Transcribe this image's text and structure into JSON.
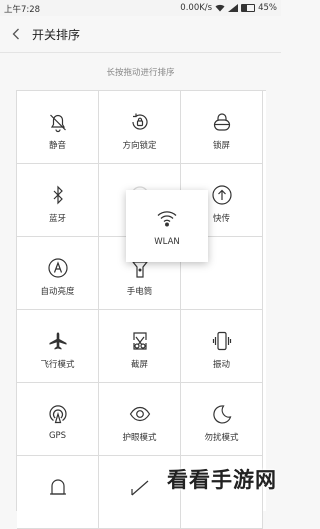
{
  "status_bar": {
    "time": "上午7:28",
    "speed": "0.00K/s",
    "battery": "45%"
  },
  "header": {
    "title": "开关排序"
  },
  "hint": "长按拖动进行排序",
  "tiles": [
    {
      "label": "静音",
      "icon": "bell-off-icon"
    },
    {
      "label": "方向锁定",
      "icon": "rotation-lock-icon"
    },
    {
      "label": "锁屏",
      "icon": "lock-icon"
    },
    {
      "label": "蓝牙",
      "icon": "bluetooth-icon"
    },
    {
      "label": "",
      "icon": "empty-slot"
    },
    {
      "label": "快传",
      "icon": "upload-icon"
    },
    {
      "label": "自动亮度",
      "icon": "auto-brightness-icon"
    },
    {
      "label": "手电筒",
      "icon": "flashlight-icon"
    },
    {
      "label": "",
      "icon": "empty"
    },
    {
      "label": "飞行模式",
      "icon": "airplane-icon"
    },
    {
      "label": "截屏",
      "icon": "screenshot-icon"
    },
    {
      "label": "振动",
      "icon": "vibrate-icon"
    },
    {
      "label": "GPS",
      "icon": "gps-icon"
    },
    {
      "label": "护眼模式",
      "icon": "eye-icon"
    },
    {
      "label": "勿扰模式",
      "icon": "moon-icon"
    },
    {
      "label": "",
      "icon": "partial-icon"
    },
    {
      "label": "",
      "icon": "partial-icon"
    },
    {
      "label": "",
      "icon": "empty"
    }
  ],
  "dragging_tile": {
    "label": "WLAN",
    "icon": "wifi-icon"
  },
  "watermark": "看看手游网"
}
